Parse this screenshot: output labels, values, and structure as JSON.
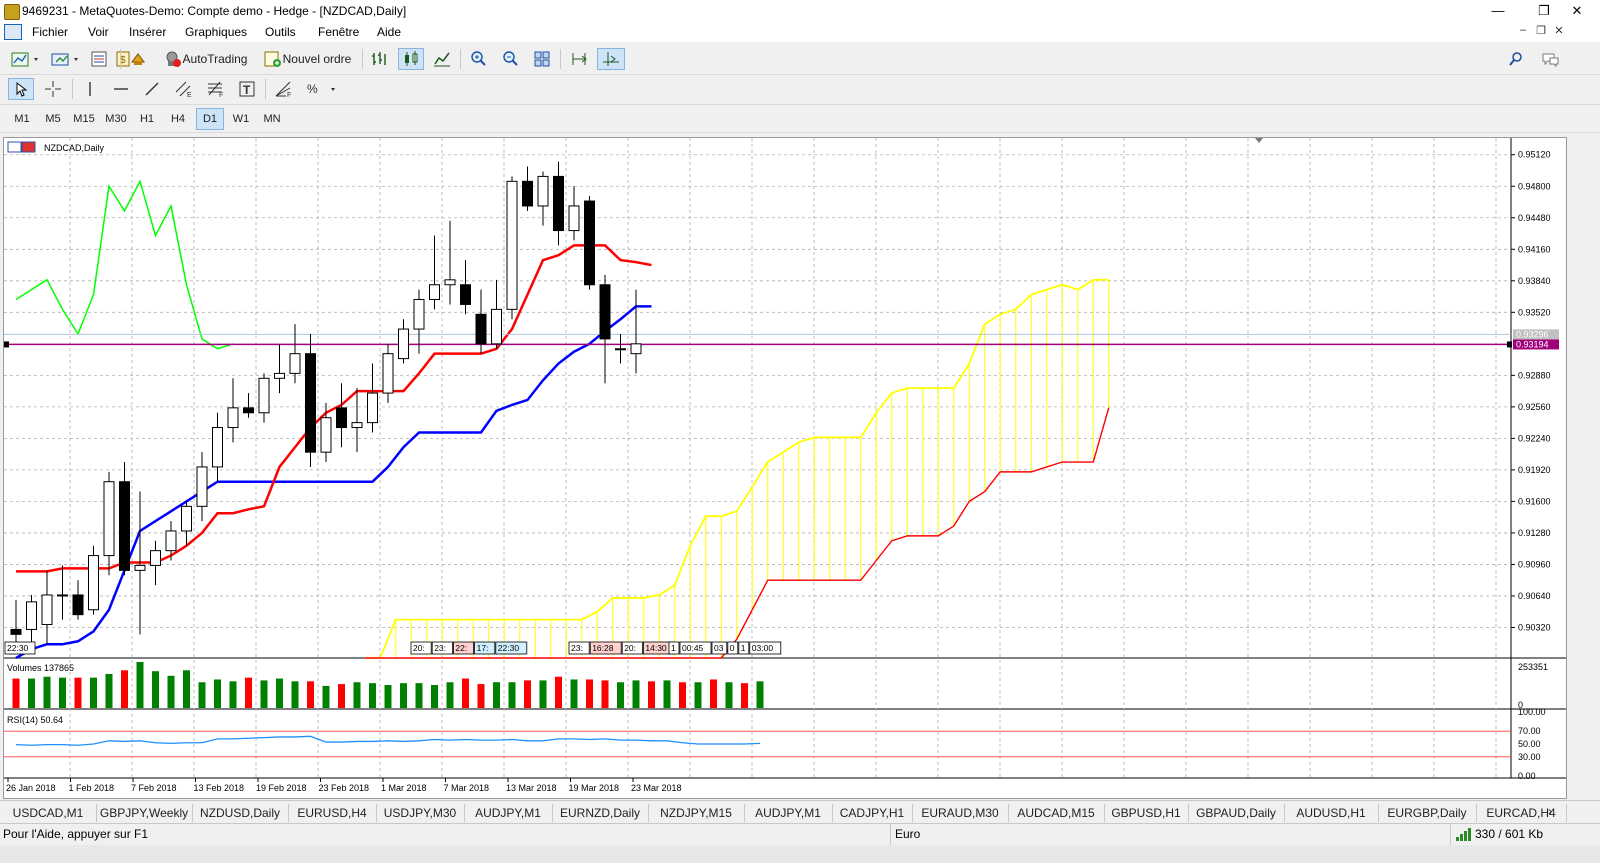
{
  "window": {
    "title": "9469231 - MetaQuotes-Demo: Compte demo - Hedge - [NZDCAD,Daily]",
    "minimize": "—",
    "maximize": "❐",
    "close": "✕"
  },
  "menu": [
    "Fichier",
    "Voir",
    "Insérer",
    "Graphiques",
    "Outils",
    "Fenêtre",
    "Aide"
  ],
  "toolbar": {
    "autotrading_label": "AutoTrading",
    "new_order_label": "Nouvel ordre"
  },
  "timeframes": [
    "M1",
    "M5",
    "M15",
    "M30",
    "H1",
    "H4",
    "D1",
    "W1",
    "MN"
  ],
  "active_timeframe": "D1",
  "chart": {
    "symbol_label": "NZDCAD,Daily",
    "volumes_label": "Volumes 137865",
    "rsi_label": "RSI(14) 50.64",
    "volume_axis": [
      "253351",
      "0"
    ],
    "rsi_axis": [
      "100.00",
      "70.00",
      "50.00",
      "30.00",
      "0.00"
    ],
    "price_badge_bid": "0.93296",
    "price_badge_line": "0.93194",
    "time_markers_left": "22:30",
    "time_markers_a": [
      "20:",
      "23:",
      "22:",
      "17:",
      "22:30"
    ],
    "time_markers_b": [
      "23:",
      "16:28",
      "20:",
      "14:30"
    ],
    "time_markers_c": [
      "1",
      "00:45"
    ],
    "time_markers_d": [
      "03",
      "0",
      "1",
      "03:00"
    ]
  },
  "colors": {
    "bull": "#ffffff",
    "bear": "#000000",
    "tenkan": "#ff0000",
    "kijun": "#0000ff",
    "chikou": "#00ff00",
    "kumo": "#ffff00",
    "hline": "#a0007a",
    "vol_up": "#008000",
    "vol_down": "#ff0000",
    "rsi": "#1e90ff",
    "grid": "#b0b0b0"
  },
  "chart_data": {
    "type": "candlestick",
    "y_ticks": [
      "0.95120",
      "0.94800",
      "0.94480",
      "0.94160",
      "0.93840",
      "0.93520",
      "0.92880",
      "0.92560",
      "0.92240",
      "0.91920",
      "0.91600",
      "0.91280",
      "0.90960",
      "0.90640",
      "0.90320"
    ],
    "x_ticks": [
      "26 Jan 2018",
      "1 Feb 2018",
      "7 Feb 2018",
      "13 Feb 2018",
      "19 Feb 2018",
      "23 Feb 2018",
      "1 Mar 2018",
      "7 Mar 2018",
      "13 Mar 2018",
      "19 Mar 2018",
      "23 Mar 2018"
    ],
    "ylim": [
      0.9001,
      0.9529
    ],
    "candles": [
      {
        "o": 0.903,
        "h": 0.906,
        "l": 0.9005,
        "c": 0.9025
      },
      {
        "o": 0.903,
        "h": 0.9065,
        "l": 0.901,
        "c": 0.9058
      },
      {
        "o": 0.9035,
        "h": 0.909,
        "l": 0.9015,
        "c": 0.9065
      },
      {
        "o": 0.9065,
        "h": 0.9095,
        "l": 0.904,
        "c": 0.9065
      },
      {
        "o": 0.9065,
        "h": 0.908,
        "l": 0.904,
        "c": 0.9045
      },
      {
        "o": 0.905,
        "h": 0.9115,
        "l": 0.9045,
        "c": 0.9105
      },
      {
        "o": 0.9105,
        "h": 0.919,
        "l": 0.9085,
        "c": 0.918
      },
      {
        "o": 0.918,
        "h": 0.92,
        "l": 0.9085,
        "c": 0.909
      },
      {
        "o": 0.909,
        "h": 0.917,
        "l": 0.9025,
        "c": 0.9095
      },
      {
        "o": 0.9095,
        "h": 0.912,
        "l": 0.9075,
        "c": 0.911
      },
      {
        "o": 0.911,
        "h": 0.914,
        "l": 0.91,
        "c": 0.913
      },
      {
        "o": 0.913,
        "h": 0.916,
        "l": 0.9115,
        "c": 0.9155
      },
      {
        "o": 0.9155,
        "h": 0.921,
        "l": 0.914,
        "c": 0.9195
      },
      {
        "o": 0.9195,
        "h": 0.925,
        "l": 0.918,
        "c": 0.9235
      },
      {
        "o": 0.9235,
        "h": 0.9285,
        "l": 0.922,
        "c": 0.9255
      },
      {
        "o": 0.9255,
        "h": 0.927,
        "l": 0.9245,
        "c": 0.925
      },
      {
        "o": 0.925,
        "h": 0.929,
        "l": 0.924,
        "c": 0.9285
      },
      {
        "o": 0.9285,
        "h": 0.932,
        "l": 0.927,
        "c": 0.929
      },
      {
        "o": 0.929,
        "h": 0.934,
        "l": 0.928,
        "c": 0.931
      },
      {
        "o": 0.931,
        "h": 0.933,
        "l": 0.9195,
        "c": 0.921
      },
      {
        "o": 0.921,
        "h": 0.926,
        "l": 0.92,
        "c": 0.9245
      },
      {
        "o": 0.9255,
        "h": 0.928,
        "l": 0.9215,
        "c": 0.9235
      },
      {
        "o": 0.9235,
        "h": 0.9275,
        "l": 0.921,
        "c": 0.924
      },
      {
        "o": 0.924,
        "h": 0.93,
        "l": 0.923,
        "c": 0.927
      },
      {
        "o": 0.927,
        "h": 0.932,
        "l": 0.926,
        "c": 0.931
      },
      {
        "o": 0.9305,
        "h": 0.9345,
        "l": 0.93,
        "c": 0.9335
      },
      {
        "o": 0.9335,
        "h": 0.9375,
        "l": 0.931,
        "c": 0.9365
      },
      {
        "o": 0.9365,
        "h": 0.943,
        "l": 0.9355,
        "c": 0.938
      },
      {
        "o": 0.938,
        "h": 0.9445,
        "l": 0.936,
        "c": 0.9385
      },
      {
        "o": 0.938,
        "h": 0.9405,
        "l": 0.935,
        "c": 0.936
      },
      {
        "o": 0.935,
        "h": 0.9375,
        "l": 0.931,
        "c": 0.932
      },
      {
        "o": 0.932,
        "h": 0.9385,
        "l": 0.9315,
        "c": 0.9355
      },
      {
        "o": 0.9355,
        "h": 0.949,
        "l": 0.9345,
        "c": 0.9485
      },
      {
        "o": 0.9485,
        "h": 0.95,
        "l": 0.9455,
        "c": 0.946
      },
      {
        "o": 0.946,
        "h": 0.9495,
        "l": 0.944,
        "c": 0.949
      },
      {
        "o": 0.949,
        "h": 0.9505,
        "l": 0.942,
        "c": 0.9435
      },
      {
        "o": 0.9435,
        "h": 0.948,
        "l": 0.9425,
        "c": 0.946
      },
      {
        "o": 0.9465,
        "h": 0.947,
        "l": 0.9375,
        "c": 0.938
      },
      {
        "o": 0.938,
        "h": 0.939,
        "l": 0.928,
        "c": 0.9325
      },
      {
        "o": 0.9315,
        "h": 0.933,
        "l": 0.93,
        "c": 0.9315
      },
      {
        "o": 0.931,
        "h": 0.9375,
        "l": 0.929,
        "c": 0.932
      }
    ],
    "tenkan": [
      0.9089,
      0.9089,
      0.9089,
      0.9092,
      0.9092,
      0.9092,
      0.9092,
      0.9098,
      0.9098,
      0.9098,
      0.9105,
      0.9115,
      0.9128,
      0.9148,
      0.9148,
      0.9152,
      0.9155,
      0.9195,
      0.9215,
      0.9235,
      0.925,
      0.9258,
      0.9272,
      0.9272,
      0.9272,
      0.9272,
      0.929,
      0.931,
      0.931,
      0.931,
      0.931,
      0.9315,
      0.9335,
      0.937,
      0.9405,
      0.941,
      0.942,
      0.942,
      0.942,
      0.9405,
      0.9403,
      0.94
    ],
    "kijun": [
      0.899,
      0.901,
      0.9015,
      0.9015,
      0.9018,
      0.9028,
      0.905,
      0.909,
      0.913,
      0.914,
      0.915,
      0.916,
      0.917,
      0.918,
      0.918,
      0.918,
      0.918,
      0.918,
      0.918,
      0.918,
      0.918,
      0.918,
      0.918,
      0.918,
      0.9195,
      0.9215,
      0.923,
      0.923,
      0.923,
      0.923,
      0.923,
      0.9252,
      0.9258,
      0.9263,
      0.9283,
      0.93,
      0.9312,
      0.932,
      0.9333,
      0.9345,
      0.9358,
      0.9358
    ],
    "chikou": [
      0.9365,
      0.9375,
      0.9385,
      0.9355,
      0.933,
      0.937,
      0.948,
      0.9455,
      0.9485,
      0.943,
      0.946,
      0.938,
      0.9325,
      0.9315,
      0.932
    ],
    "kumo_top": [
      0.8978,
      0.8987,
      0.904,
      0.904,
      0.904,
      0.904,
      0.904,
      0.904,
      0.904,
      0.904,
      0.904,
      0.904,
      0.904,
      0.904,
      0.904,
      0.9048,
      0.9062,
      0.9062,
      0.9062,
      0.9065,
      0.9075,
      0.9115,
      0.9145,
      0.9145,
      0.915,
      0.9175,
      0.92,
      0.921,
      0.922,
      0.9225,
      0.9225,
      0.9225,
      0.9225,
      0.925,
      0.927,
      0.9275,
      0.9275,
      0.9275,
      0.9275,
      0.93,
      0.934,
      0.935,
      0.9355,
      0.937,
      0.9375,
      0.938,
      0.9375,
      0.9385,
      0.9385
    ],
    "kumo_bottom": [
      0.8978,
      0.8987,
      0.8978,
      0.8978,
      0.8978,
      0.8978,
      0.8978,
      0.8978,
      0.8978,
      0.8978,
      0.8978,
      0.8978,
      0.8978,
      0.8978,
      0.8978,
      0.8978,
      0.8978,
      0.8978,
      0.8978,
      0.8978,
      0.8978,
      0.8978,
      0.8978,
      0.8978,
      0.902,
      0.905,
      0.908,
      0.908,
      0.908,
      0.908,
      0.908,
      0.908,
      0.908,
      0.91,
      0.912,
      0.9125,
      0.9125,
      0.9125,
      0.9135,
      0.916,
      0.917,
      0.919,
      0.919,
      0.919,
      0.9195,
      0.92,
      0.92,
      0.92,
      0.9255
    ],
    "hline": 0.93194,
    "volumes_pct": [
      64,
      64,
      68,
      66,
      66,
      66,
      74,
      82,
      100,
      80,
      70,
      82,
      56,
      62,
      58,
      66,
      60,
      64,
      58,
      58,
      48,
      52,
      56,
      54,
      50,
      54,
      54,
      50,
      56,
      64,
      52,
      56,
      56,
      60,
      60,
      68,
      62,
      62,
      60,
      56,
      60,
      58,
      60,
      56,
      56,
      62,
      56,
      54,
      58
    ],
    "rsi": [
      49,
      48,
      49,
      49,
      48,
      50,
      55,
      54,
      55,
      52,
      51,
      52,
      52,
      58,
      58,
      59,
      60,
      61,
      61,
      62,
      53,
      53,
      54,
      54,
      55,
      54,
      55,
      57,
      56,
      57,
      56,
      56,
      57,
      55,
      55,
      58,
      58,
      57,
      58,
      56,
      56,
      55,
      55,
      52,
      50,
      50,
      50,
      50,
      51
    ]
  },
  "tabs": [
    "USDCAD,M1",
    "GBPJPY,Weekly",
    "NZDUSD,Daily",
    "EURUSD,H4",
    "USDJPY,M30",
    "AUDJPY,M1",
    "EURNZD,Daily",
    "NZDJPY,M15",
    "AUDJPY,M1",
    "CADJPY,H1",
    "EURAUD,M30",
    "AUDCAD,M15",
    "GBPUSD,H1",
    "GBPAUD,Daily",
    "AUDUSD,H1",
    "EURGBP,Daily",
    "EURCAD,H4"
  ],
  "status": {
    "help": "Pour l'Aide, appuyer sur F1",
    "profile": "Euro",
    "traffic": "330 / 601 Kb"
  }
}
